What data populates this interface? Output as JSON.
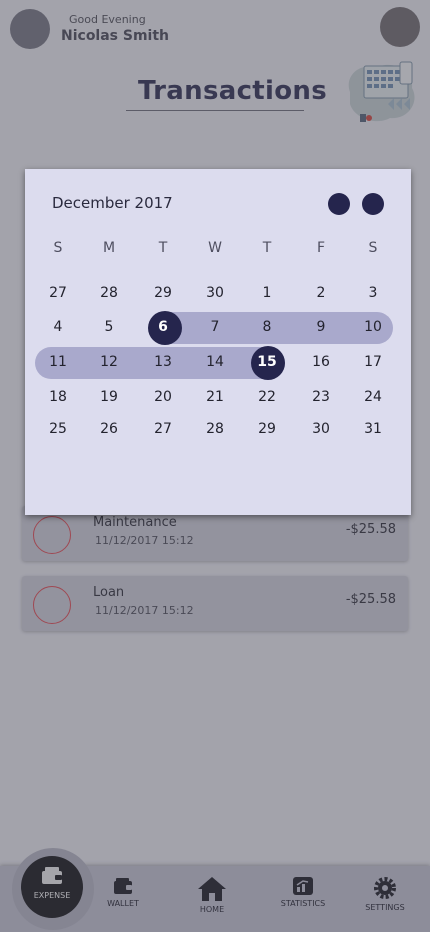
{
  "header": {
    "greeting": "Good Evening",
    "user_name": "Nicolas Smith",
    "page_title": "Transactions"
  },
  "transactions": [
    {
      "name": "Maintenance",
      "datetime": "11/12/2017 15:12",
      "amount": "-$25.58"
    },
    {
      "name": "Loan",
      "datetime": "11/12/2017 15:12",
      "amount": "-$25.58"
    }
  ],
  "calendar": {
    "month_label": "December 2017",
    "weekdays": [
      "S",
      "M",
      "T",
      "W",
      "T",
      "F",
      "S"
    ],
    "weeks": [
      [
        "27",
        "28",
        "29",
        "30",
        "1",
        "2",
        "3"
      ],
      [
        "4",
        "5",
        "6",
        "7",
        "8",
        "9",
        "10"
      ],
      [
        "11",
        "12",
        "13",
        "14",
        "15",
        "16",
        "17"
      ],
      [
        "18",
        "19",
        "20",
        "21",
        "22",
        "23",
        "24"
      ],
      [
        "25",
        "26",
        "27",
        "28",
        "29",
        "30",
        "31"
      ]
    ],
    "range_start": "6",
    "range_end": "15"
  },
  "nav": {
    "expense": "EXPENSE",
    "wallet": "WALLET",
    "home": "HOME",
    "statistics": "STATISTICS",
    "settings": "SETTINGS"
  },
  "colors": {
    "accent": "#25254d",
    "range_band": "#a9a9cc",
    "expense_ring": "#e74a53"
  }
}
